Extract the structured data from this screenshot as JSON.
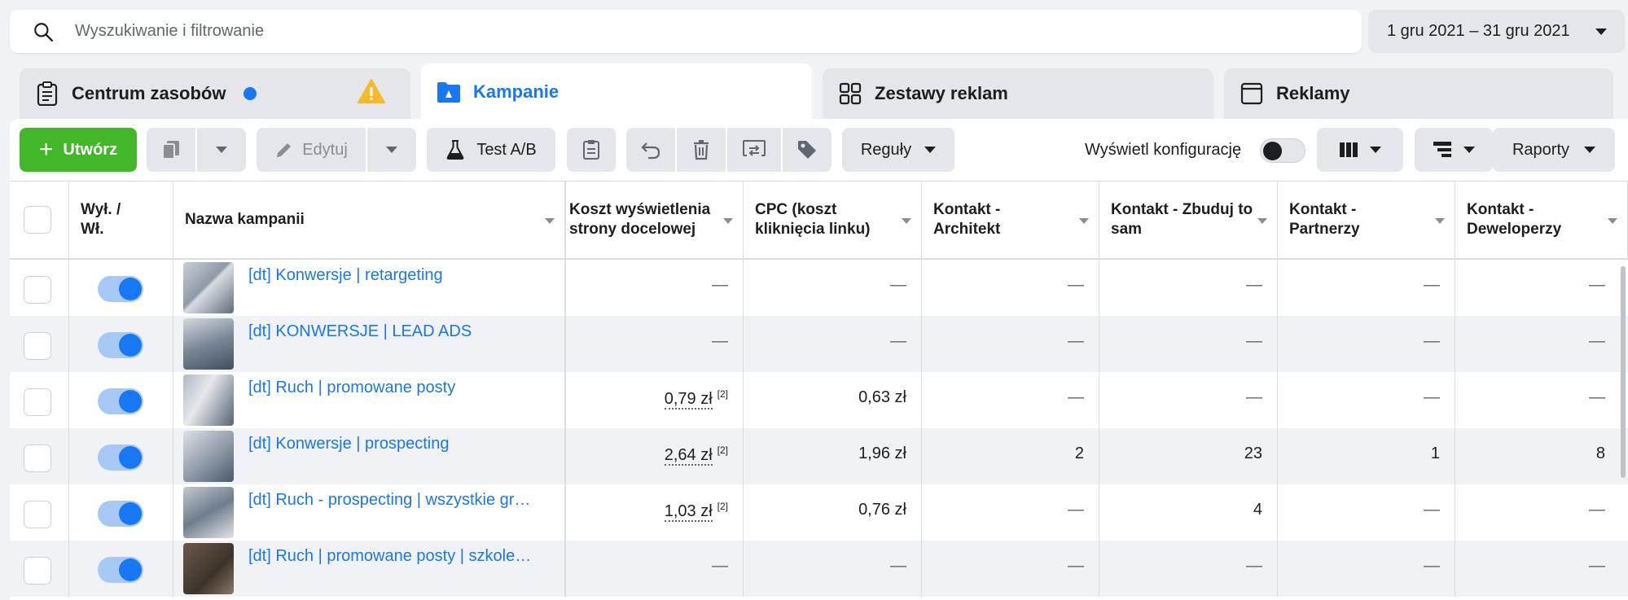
{
  "search": {
    "placeholder": "Wyszukiwanie i filtrowanie"
  },
  "date_range": {
    "label": "1 gru 2021 – 31 gru 2021"
  },
  "tabs": [
    {
      "label": "Centrum zasobów",
      "icon": "clipboard-icon"
    },
    {
      "label": "Kampanie",
      "icon": "folder-icon",
      "active": true
    },
    {
      "label": "Zestawy reklam",
      "icon": "grid-icon"
    },
    {
      "label": "Reklamy",
      "icon": "window-icon"
    }
  ],
  "toolbar": {
    "create_label": "Utwórz",
    "edit_label": "Edytuj",
    "ab_test_label": "Test A/B",
    "rules_label": "Reguły",
    "config_label": "Wyświetl konfigurację",
    "reports_label": "Raporty"
  },
  "table": {
    "headers": {
      "toggle": "Wył. / Wł.",
      "name": "Nazwa kampanii",
      "cost_landing": "Koszt wyświetlenia strony docelowej",
      "cpc": "CPC (koszt kliknięcia linku)",
      "architect": "Kontakt - Architekt",
      "diy": "Kontakt - Zbuduj to sam",
      "partners": "Kontakt - Partnerzy",
      "developers": "Kontakt - Deweloperzy"
    },
    "rows": [
      {
        "name": "[dt] Konwersje | retargeting",
        "cost_landing": "—",
        "cost_note": "",
        "cpc": "—",
        "architect": "—",
        "diy": "—",
        "partners": "—",
        "developers": "—"
      },
      {
        "name": "[dt] KONWERSJE | LEAD ADS",
        "cost_landing": "—",
        "cost_note": "",
        "cpc": "—",
        "architect": "—",
        "diy": "—",
        "partners": "—",
        "developers": "—"
      },
      {
        "name": "[dt] Ruch | promowane posty",
        "cost_landing": "0,79 zł",
        "cost_note": "[2]",
        "cpc": "0,63 zł",
        "architect": "—",
        "diy": "—",
        "partners": "—",
        "developers": "—"
      },
      {
        "name": "[dt] Konwersje | prospecting",
        "cost_landing": "2,64 zł",
        "cost_note": "[2]",
        "cpc": "1,96 zł",
        "architect": "2",
        "diy": "23",
        "partners": "1",
        "developers": "8"
      },
      {
        "name": "[dt] Ruch - prospecting | wszystkie gr…",
        "cost_landing": "1,03 zł",
        "cost_note": "[2]",
        "cpc": "0,76 zł",
        "architect": "—",
        "diy": "4",
        "partners": "—",
        "developers": "—"
      },
      {
        "name": "[dt] Ruch | promowane posty | szkole…",
        "cost_landing": "—",
        "cost_note": "",
        "cpc": "—",
        "architect": "—",
        "diy": "—",
        "partners": "—",
        "developers": "—"
      }
    ]
  },
  "colors": {
    "accent": "#1877f2",
    "create": "#42b72a",
    "warning": "#f7b928"
  }
}
